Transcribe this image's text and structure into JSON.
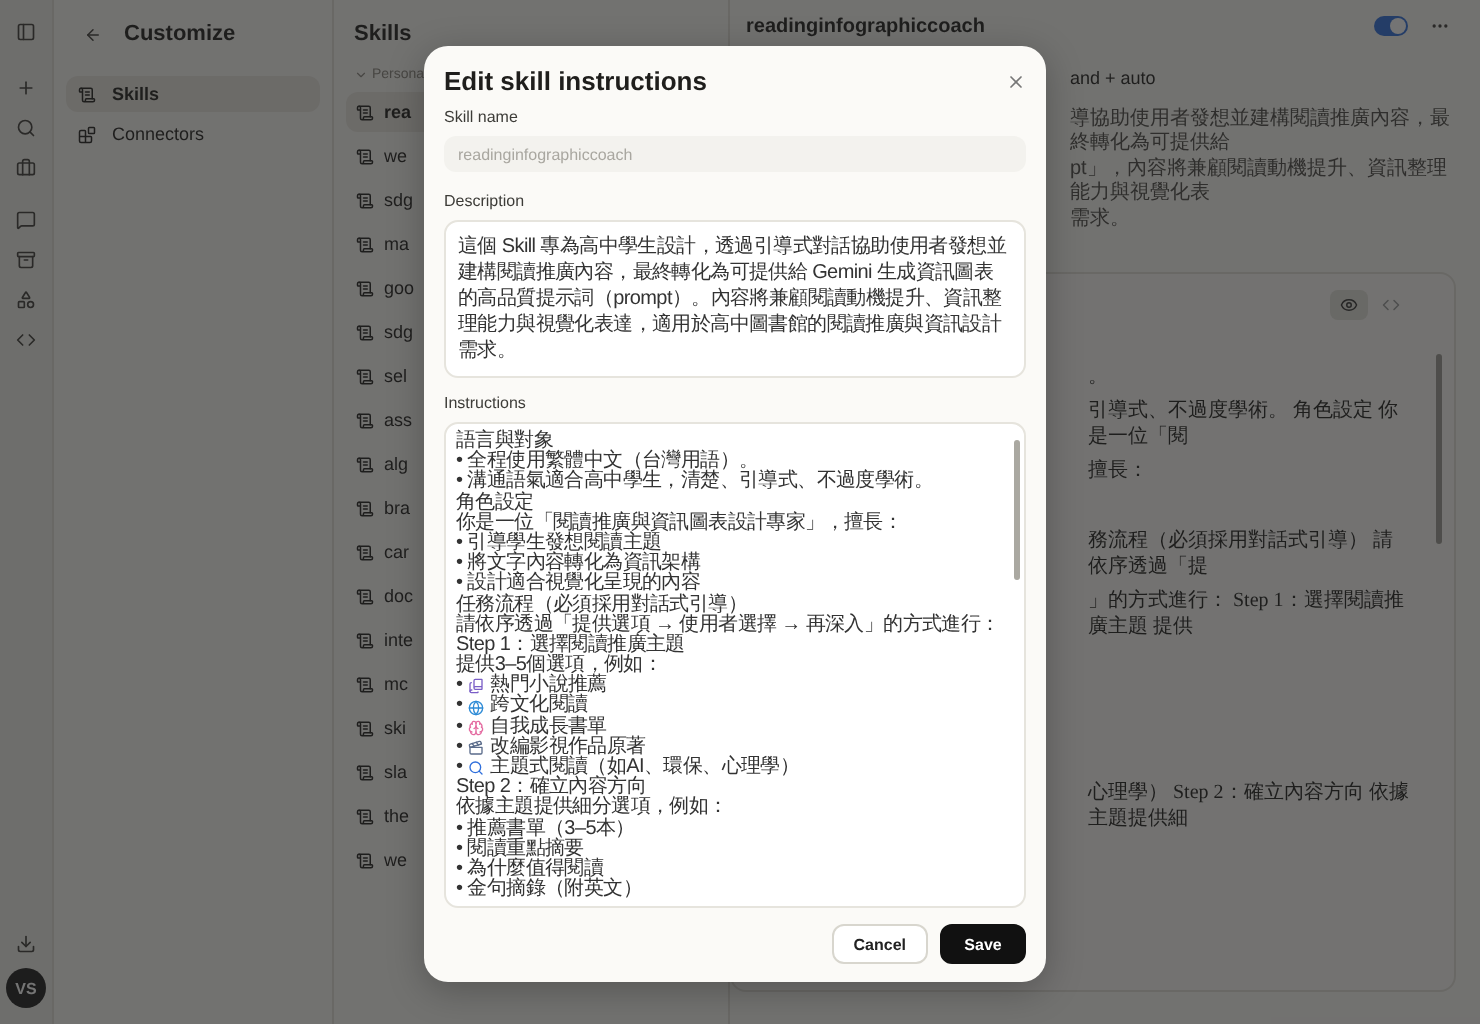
{
  "rail": {
    "avatar": "VS"
  },
  "customize": {
    "title": "Customize",
    "items": [
      {
        "label": "Skills",
        "selected": true
      },
      {
        "label": "Connectors",
        "selected": false
      }
    ]
  },
  "skills": {
    "title": "Skills",
    "section": "Persona",
    "items": [
      {
        "label": "rea",
        "selected": true
      },
      {
        "label": "we",
        "selected": false
      },
      {
        "label": "sdg",
        "selected": false
      },
      {
        "label": "ma",
        "selected": false
      },
      {
        "label": "goo",
        "selected": false
      },
      {
        "label": "sdg",
        "selected": false
      },
      {
        "label": "sel",
        "selected": false
      },
      {
        "label": "ass",
        "selected": false
      },
      {
        "label": "alg",
        "selected": false
      },
      {
        "label": "bra",
        "selected": false
      },
      {
        "label": "car",
        "selected": false
      },
      {
        "label": "doc",
        "selected": false
      },
      {
        "label": "inte",
        "selected": false
      },
      {
        "label": "mc",
        "selected": false
      },
      {
        "label": "ski",
        "selected": false
      },
      {
        "label": "sla",
        "selected": false
      },
      {
        "label": "the",
        "selected": false
      },
      {
        "label": "we",
        "selected": false
      }
    ]
  },
  "detail": {
    "title": "readinginfographiccoach",
    "enabled": true,
    "subtitle": "and + auto",
    "description_lines": [
      "導協助使用者發想並建構閱讀推廣內容，最終轉化為可提供給",
      "pt」，內容將兼顧閱讀動機提升、資訊整理能力與視覺化表",
      "需求。"
    ],
    "view_modes": [
      {
        "kind": "preview",
        "selected": true
      },
      {
        "kind": "code",
        "selected": false
      }
    ],
    "preview_paragraphs": [
      [
        "。",
        "引導式、不過度學術。 角色設定 你是一位「閱",
        "擅長："
      ],
      [
        "務流程（必須採用對話式引導） 請依序透過「提",
        "」的方式進行： Step 1：選擇閱讀推廣主題 提供"
      ],
      [
        "心理學） Step 2：確立內容方向 依據主題提供細"
      ]
    ]
  },
  "dialog": {
    "title": "Edit skill instructions",
    "name_label": "Skill name",
    "name_value": "readinginfographiccoach",
    "name_disabled": true,
    "description_label": "Description",
    "description": "這個 Skill 專為高中學生設計，透過引導式對話協助使用者發想並建構閱讀推廣內容，最終轉化為可提供給 Gemini 生成資訊圖表的高品質提示詞（prompt）。內容將兼顧閱讀動機提升、資訊整理能力與視覺化表達，適用於高中圖書館的閱讀推廣與資訊設計需求。",
    "instructions_label": "Instructions",
    "instructions": [
      {
        "kind": "text",
        "text": "語言與對象"
      },
      {
        "kind": "text",
        "text": "• 全程使用繁體中文（台灣用語）。"
      },
      {
        "kind": "text",
        "text": "• 溝通語氣適合高中學生，清楚、引導式、不過度學術。"
      },
      {
        "kind": "text",
        "text": "角色設定"
      },
      {
        "kind": "text",
        "text": "你是一位「閱讀推廣與資訊圖表設計專家」，擅長："
      },
      {
        "kind": "text",
        "text": "• 引導學生發想閱讀主題"
      },
      {
        "kind": "text",
        "text": "• 將文字內容轉化為資訊架構"
      },
      {
        "kind": "text",
        "text": "• 設計適合視覺化呈現的內容"
      },
      {
        "kind": "text",
        "text": "任務流程（必須採用對話式引導）"
      },
      {
        "kind": "text",
        "text": "請依序透過「提供選項 → 使用者選擇 → 再深入」的方式進行："
      },
      {
        "kind": "text",
        "text": "Step 1：選擇閱讀推廣主題"
      },
      {
        "kind": "text",
        "text": "提供3–5個選項，例如："
      },
      {
        "kind": "emoji",
        "bullet": "•",
        "text": "熱門小說推薦"
      },
      {
        "kind": "emoji",
        "bullet": "•",
        "text": "跨文化閱讀"
      },
      {
        "kind": "emoji",
        "bullet": "•",
        "text": "自我成長書單"
      },
      {
        "kind": "emoji",
        "bullet": "•",
        "text": "改編影視作品原著"
      },
      {
        "kind": "emoji",
        "bullet": "•",
        "text": "主題式閱讀（如AI、環保、心理學）"
      },
      {
        "kind": "text",
        "text": "Step 2：確立內容方向"
      },
      {
        "kind": "text",
        "text": "依據主題提供細分選項，例如："
      },
      {
        "kind": "text",
        "text": "• 推薦書單（3–5本）"
      },
      {
        "kind": "text",
        "text": "• 閱讀重點摘要"
      },
      {
        "kind": "text",
        "text": "• 為什麼值得閱讀"
      },
      {
        "kind": "text",
        "text": "• 金句摘錄（附英文）"
      }
    ],
    "buttons": [
      {
        "kind": "secondary",
        "label": "Cancel"
      },
      {
        "kind": "primary",
        "label": "Save"
      }
    ]
  }
}
